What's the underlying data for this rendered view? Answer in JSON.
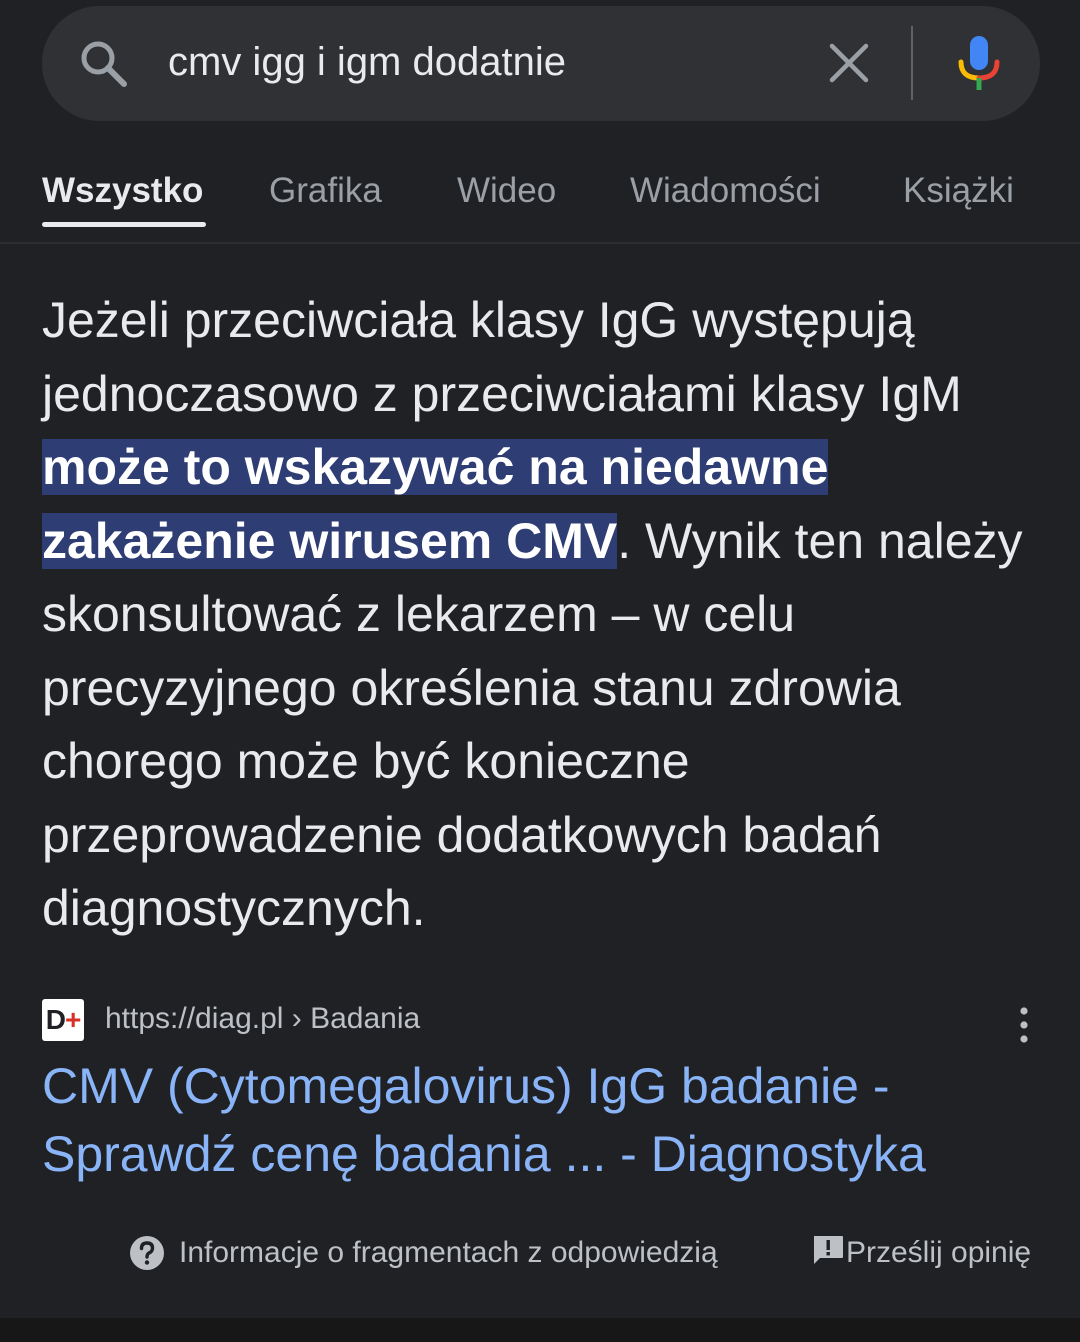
{
  "search": {
    "query": "cmv igg i igm dodatnie"
  },
  "tabs": [
    {
      "label": "Wszystko",
      "active": true
    },
    {
      "label": "Grafika",
      "active": false
    },
    {
      "label": "Wideo",
      "active": false
    },
    {
      "label": "Wiadomości",
      "active": false
    },
    {
      "label": "Książki",
      "active": false
    }
  ],
  "snippet": {
    "text_before": "Jeżeli przeciwciała klasy IgG występują jednoczasowo z przeciwciałami klasy IgM ",
    "highlight": "może to wskazywać na niedawne zakażenie wirusem CMV",
    "text_after": ". Wynik ten należy skonsultować z lekarzem – w celu precyzyjnego określenia stanu zdrowia chorego może być konieczne przeprowadzenie dodatkowych badań diagnostycznych."
  },
  "source": {
    "favicon_letter": "D",
    "favicon_plus": "+",
    "url": "https://diag.pl › Badania",
    "title": "CMV (Cytomegalovirus) IgG badanie - Sprawdź cenę badania ... - Diagnostyka"
  },
  "footer": {
    "info_label": "Informacje o fragmentach z odpowiedzią",
    "feedback_label": "Prześlij opinię"
  },
  "colors": {
    "background": "#202124",
    "searchbar": "#303134",
    "highlight": "#2e3d73",
    "link": "#8ab4f8"
  }
}
